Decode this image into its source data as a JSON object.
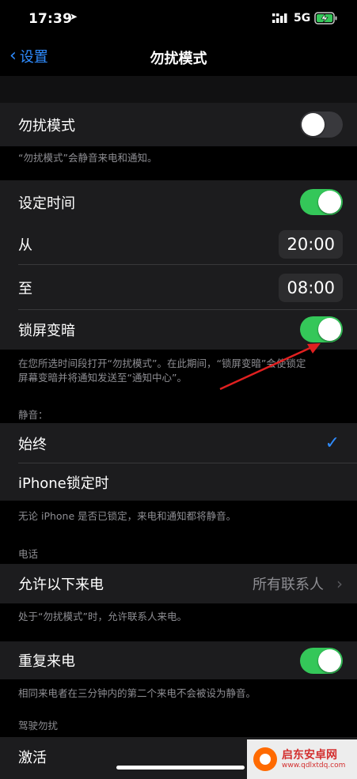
{
  "status": {
    "time": "17:39",
    "network": "5G"
  },
  "nav": {
    "back_label": "设置",
    "title": "勿扰模式"
  },
  "dnd": {
    "label": "勿扰模式",
    "enabled": false,
    "footer": "“勿扰模式”会静音来电和通知。"
  },
  "schedule": {
    "label": "设定时间",
    "enabled": true,
    "from_label": "从",
    "from_value": "20:00",
    "to_label": "至",
    "to_value": "08:00",
    "dim_label": "锁屏变暗",
    "dim_enabled": true,
    "footer_line1": "在您所选时间段打开“勿扰模式”。在此期间，“锁屏变暗”会使锁定",
    "footer_line2": "屏幕变暗并将通知发送至“通知中心”。"
  },
  "silence": {
    "section_label": "静音：",
    "always_label": "始终",
    "locked_label": "iPhone锁定时",
    "footer": "无论 iPhone 是否已锁定，来电和通知都将静音。"
  },
  "phone": {
    "section_label": "电话",
    "allow_label": "允许以下来电",
    "allow_value": "所有联系人",
    "footer": "处于“勿扰模式”时，允许联系人来电。",
    "repeat_label": "重复来电",
    "repeat_enabled": true,
    "repeat_footer": "相同来电者在三分钟内的第二个来电不会被设为静音。"
  },
  "driving": {
    "section_label": "驾驶勿扰",
    "activate_label": "激活"
  },
  "watermark": {
    "name": "启东安卓网",
    "url": "www.qdlxtdq.com"
  },
  "colors": {
    "accent": "#2f8cff",
    "toggle_on": "#34c759",
    "annotation_arrow": "#e02020"
  }
}
